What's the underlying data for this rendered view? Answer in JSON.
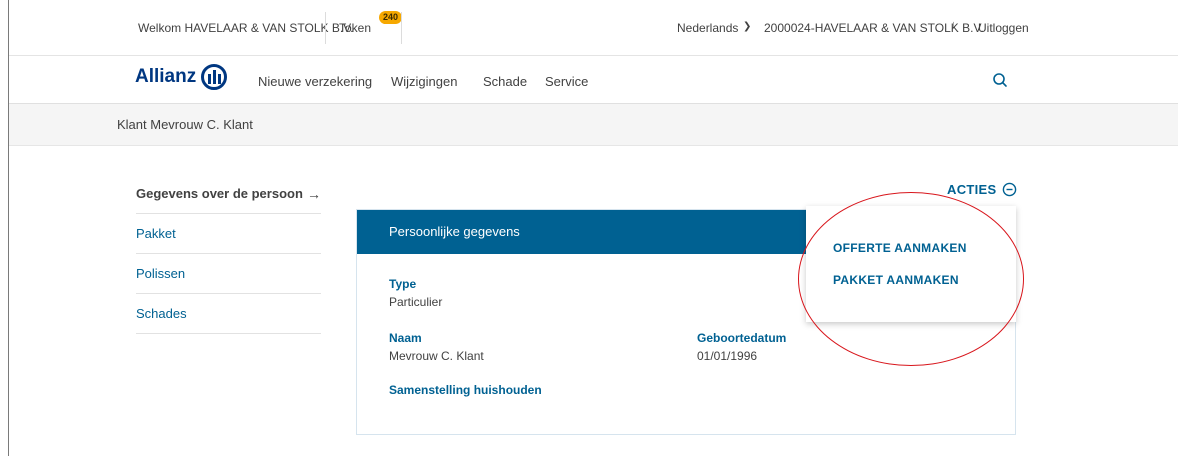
{
  "topbar": {
    "welcome": "Welkom HAVELAAR & VAN STOLK B.V.",
    "token_label": "Token",
    "token_count": "240",
    "language": "Nederlands",
    "account": "2000024-HAVELAAR & VAN STOLK B.V.",
    "logout": "Uitloggen"
  },
  "nav": {
    "brand": "Allianz",
    "items": [
      "Nieuwe verzekering",
      "Wijzigingen",
      "Schade",
      "Service"
    ]
  },
  "breadcrumb": "Klant Mevrouw C. Klant",
  "sidebar": {
    "items": [
      {
        "label": "Gegevens over de persoon",
        "active": true
      },
      {
        "label": "Pakket"
      },
      {
        "label": "Polissen"
      },
      {
        "label": "Schades"
      }
    ]
  },
  "actions": {
    "label": "ACTIES",
    "menu": [
      "OFFERTE AANMAKEN",
      "PAKKET AANMAKEN"
    ]
  },
  "card": {
    "title": "Persoonlijke gegevens",
    "type_label": "Type",
    "type_value": "Particulier",
    "name_label": "Naam",
    "name_value": "Mevrouw C. Klant",
    "birth_label": "Geboortedatum",
    "birth_value": "01/01/1996",
    "household_label": "Samenstelling huishouden"
  },
  "colors": {
    "brand_blue": "#003781",
    "accent_blue": "#006192",
    "badge": "#f6a800",
    "annotation_red": "#d8161c"
  },
  "icons": [
    "chevron-down-icon",
    "arrow-right-icon",
    "search-icon",
    "minus-circle-icon",
    "allianz-logo-icon"
  ]
}
